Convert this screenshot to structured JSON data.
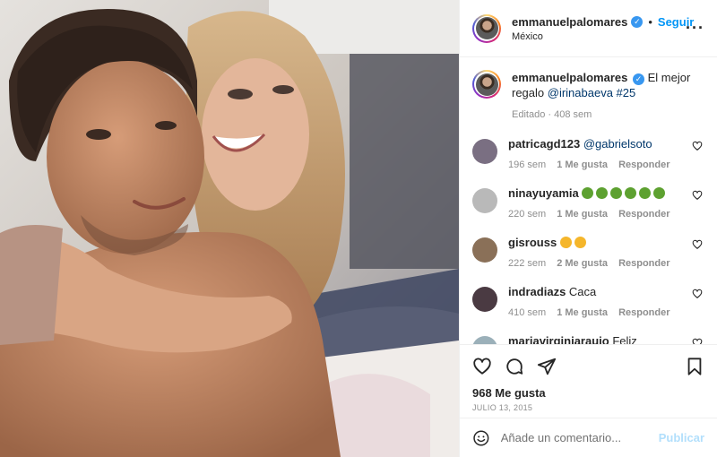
{
  "post": {
    "author": "emmanuelpalomares",
    "follow_label": "Seguir",
    "location": "México",
    "more_icon": "more-options-icon"
  },
  "caption": {
    "username": "emmanuelpalomares",
    "text_before": "El mejor regalo ",
    "mention": "@irinabaeva",
    "hashtag": " #25",
    "edited": "Editado",
    "age": "408 sem"
  },
  "comments": [
    {
      "username": "patricagd123",
      "text": "@gabrielsoto",
      "age": "196 sem",
      "likes": "1 Me gusta",
      "reply": "Responder",
      "avatar_color": "#7a6f82"
    },
    {
      "username": "ninayuyamia",
      "text": "",
      "emoji_count": 6,
      "emoji_color": "#5da130",
      "age": "220 sem",
      "likes": "1 Me gusta",
      "reply": "Responder",
      "avatar_color": "#b9b9b9"
    },
    {
      "username": "gisrouss",
      "text": "",
      "emoji_count": 2,
      "emoji_color": "#f5b62b",
      "age": "222 sem",
      "likes": "2 Me gusta",
      "reply": "Responder",
      "avatar_color": "#8a7058"
    },
    {
      "username": "indradiazs",
      "text": "Caca",
      "age": "410 sem",
      "likes": "1 Me gusta",
      "reply": "Responder",
      "avatar_color": "#4a3a42"
    },
    {
      "username": "mariavirginiaraujo",
      "text": "Feliz",
      "age": "",
      "likes": "",
      "reply": "",
      "avatar_color": "#9bb0b9"
    }
  ],
  "actions": {
    "likes": "968 Me gusta",
    "date": "JULIO 13, 2015"
  },
  "composer": {
    "placeholder": "Añade un comentario...",
    "publish_label": "Publicar"
  },
  "colors": {
    "link": "#0095f6",
    "verified": "#3897f0",
    "muted": "#8e8e8e"
  }
}
